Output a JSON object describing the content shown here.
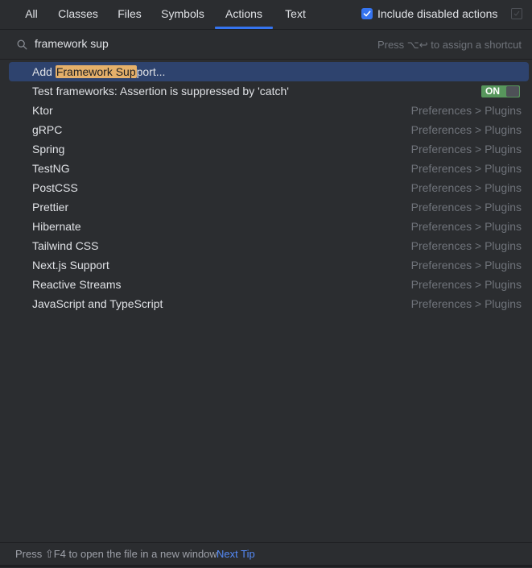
{
  "tabs": [
    {
      "label": "All",
      "active": false
    },
    {
      "label": "Classes",
      "active": false
    },
    {
      "label": "Files",
      "active": false
    },
    {
      "label": "Symbols",
      "active": false
    },
    {
      "label": "Actions",
      "active": true
    },
    {
      "label": "Text",
      "active": false
    }
  ],
  "include_disabled": {
    "label": "Include disabled actions",
    "checked": true
  },
  "search": {
    "value": "framework sup",
    "hint": "Press ⌥↩ to assign a shortcut"
  },
  "results": [
    {
      "prefix": "Add ",
      "highlight": "Framework Sup",
      "suffix": "port...",
      "right": "",
      "selected": true
    },
    {
      "label": "Test frameworks: Assertion is suppressed by 'catch'",
      "toggle": "ON"
    },
    {
      "label": "Ktor",
      "right": "Preferences > Plugins"
    },
    {
      "label": "gRPC",
      "right": "Preferences > Plugins"
    },
    {
      "label": "Spring",
      "right": "Preferences > Plugins"
    },
    {
      "label": "TestNG",
      "right": "Preferences > Plugins"
    },
    {
      "label": "PostCSS",
      "right": "Preferences > Plugins"
    },
    {
      "label": "Prettier",
      "right": "Preferences > Plugins"
    },
    {
      "label": "Hibernate",
      "right": "Preferences > Plugins"
    },
    {
      "label": "Tailwind CSS",
      "right": "Preferences > Plugins"
    },
    {
      "label": "Next.js Support",
      "right": "Preferences > Plugins"
    },
    {
      "label": "Reactive Streams",
      "right": "Preferences > Plugins"
    },
    {
      "label": "JavaScript and TypeScript",
      "right": "Preferences > Plugins"
    }
  ],
  "footer": {
    "tip": "Press ⇧F4 to open the file in a new window",
    "next_tip": "Next Tip"
  },
  "colors": {
    "background": "#2b2d30",
    "accent": "#3574f0",
    "selection": "#2e436e",
    "match_highlight": "#e5b06a",
    "toggle_on": "#57965c"
  }
}
